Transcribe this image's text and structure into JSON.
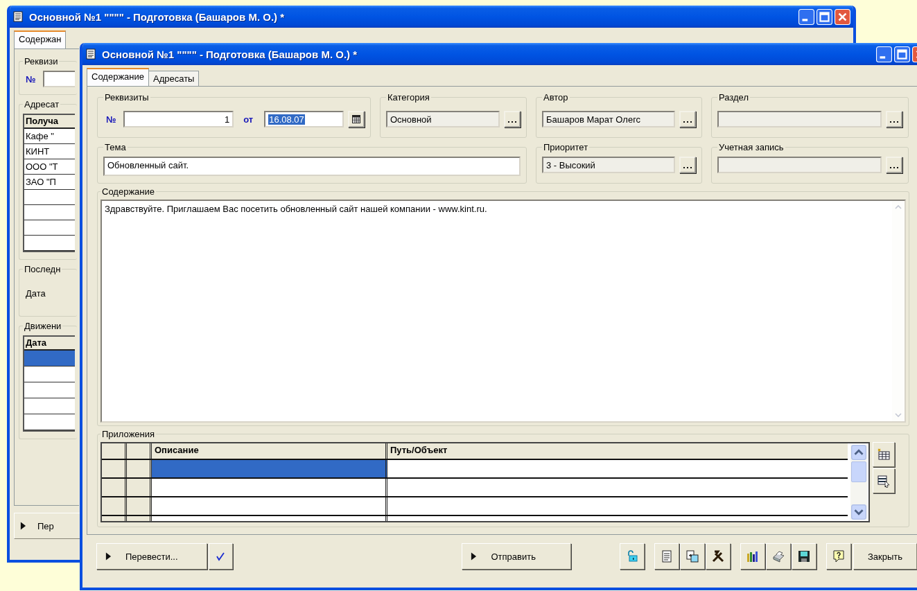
{
  "back_window": {
    "title": "Основной №1 \"\"\"\" - Подготовка (Башаров М. О.) *",
    "tabs": [
      {
        "label": "Содержан",
        "selected": true
      }
    ],
    "requisites_legend": "Реквизи",
    "number_label": "№",
    "recipients_legend": "Адресат",
    "recipients_header": "Получа",
    "recipients_rows": [
      "Кафе \"",
      "КИНТ",
      "ООО \"Т",
      "ЗАО \"П"
    ],
    "last_legend": "Последн",
    "date_label": "Дата",
    "movement_legend": "Движени",
    "movement_header": "Дата",
    "movement_rows": [
      {
        "selected": true
      },
      {
        "selected": false
      },
      {
        "selected": false
      },
      {
        "selected": false
      },
      {
        "selected": false
      }
    ],
    "button": "Пер"
  },
  "window": {
    "title": "Основной №1 \"\"\"\" - Подготовка (Башаров М. О.) *"
  },
  "tabs": [
    {
      "label": "Содержание",
      "selected": true
    },
    {
      "label": "Адресаты",
      "selected": false
    }
  ],
  "requisites": {
    "legend": "Реквизиты",
    "number_label": "№",
    "number": "1",
    "date_label": "от",
    "date": "16.08.07",
    "date_highlighted": true
  },
  "category": {
    "legend": "Категория",
    "value": "Основной"
  },
  "author": {
    "legend": "Автор",
    "value": "Башаров Марат Олегс"
  },
  "section": {
    "legend": "Раздел"
  },
  "topic": {
    "legend": "Тема",
    "value": "Обновленный сайт."
  },
  "priority": {
    "legend": "Приоритет",
    "value": "3 - Высокий"
  },
  "account": {
    "legend": "Учетная запись"
  },
  "content": {
    "legend": "Содержание",
    "text": "Здравствуйте. Приглашаем Вас посетить обновленный сайт нашей компании - www.kint.ru."
  },
  "attachments": {
    "legend": "Приложения",
    "columns": [
      "Описание",
      "Путь/Объект"
    ],
    "rows": [
      {
        "selected": true
      },
      {
        "selected": false
      },
      {
        "selected": false
      },
      {
        "selected": false
      }
    ]
  },
  "buttons": {
    "translate": "Перевести...",
    "send": "Отправить",
    "close": "Закрыть"
  }
}
